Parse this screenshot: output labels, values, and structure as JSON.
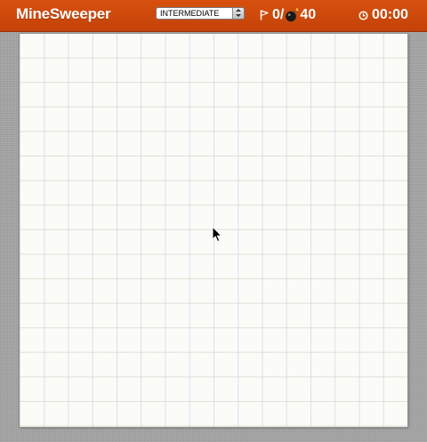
{
  "app": {
    "title": "MineSweeper"
  },
  "difficulty": {
    "selected": "INTERMEDIATE"
  },
  "counter": {
    "flags": "0/",
    "mines": "40"
  },
  "timer": {
    "value": "00:00"
  },
  "board": {
    "state": "unopened"
  },
  "icons": {
    "flag": "flag-icon",
    "bomb": "bomb-icon",
    "clock": "clock-icon",
    "cursor": "cursor-icon"
  },
  "colors": {
    "header": "#d04a0c",
    "board": "#fbfbf8",
    "background": "#a3a3a3",
    "text_light": "#ffffff"
  }
}
